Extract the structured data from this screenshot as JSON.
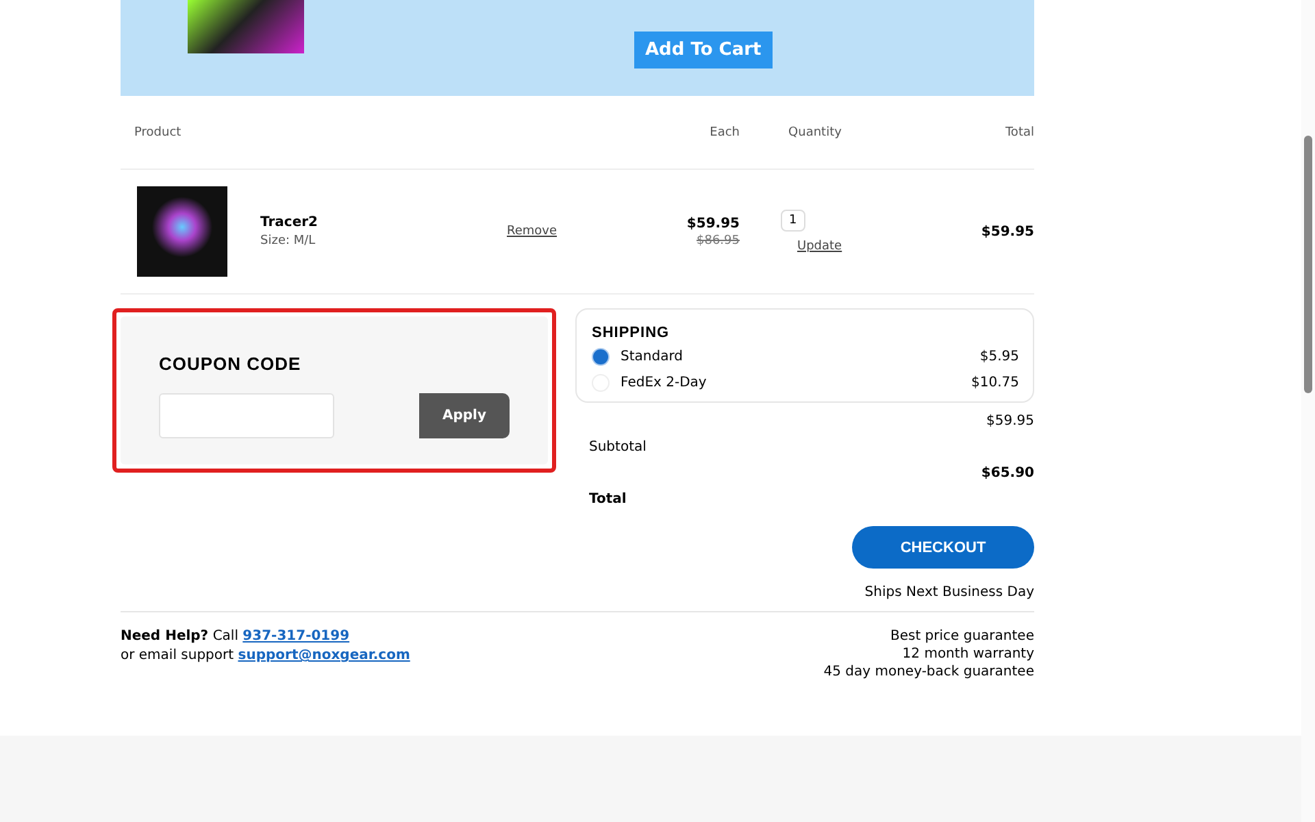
{
  "upsell": {
    "button": "Add To Cart"
  },
  "cart": {
    "columns": [
      "Product",
      "Each",
      "Quantity",
      "Total"
    ],
    "items": [
      {
        "name": "Tracer2",
        "size": "Size: M/L",
        "remove": "Remove",
        "price": "$59.95",
        "old_price": "$86.95",
        "quantity": "1",
        "update": "Update",
        "total": "$59.95"
      }
    ]
  },
  "coupon": {
    "title": "COUPON CODE",
    "button": "Apply"
  },
  "shipping": {
    "title": "SHIPPING",
    "options": [
      {
        "label": "Standard",
        "price": "$5.95",
        "selected": true
      },
      {
        "label": "FedEx 2-Day",
        "price": "$10.75",
        "selected": false
      }
    ]
  },
  "summary": {
    "subtotal_label": "Subtotal",
    "subtotal": "$59.95",
    "total_label": "Total",
    "total": "$65.90",
    "checkout": "CHECKOUT",
    "note": "Ships Next Business Day"
  },
  "help": {
    "lead": "Need Help?",
    "call": "Call",
    "phone": "937-317-0199",
    "email_text": "or email support",
    "email": "support@noxgear.com"
  },
  "guarantees": [
    "Best price guarantee",
    "12 month warranty",
    "45 day money-back guarantee"
  ]
}
